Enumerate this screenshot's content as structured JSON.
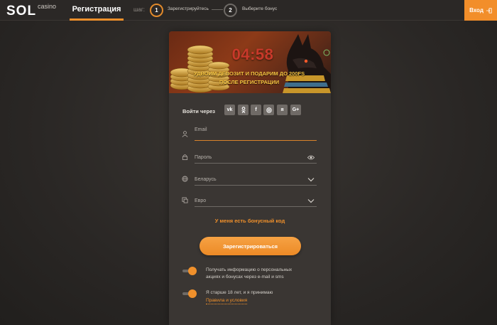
{
  "header": {
    "logo_main": "SOL",
    "logo_sub": "casino",
    "register_tab": "Регистрация",
    "steps_label": "шаг:",
    "steps": [
      {
        "number": "1",
        "label": "Зарегистрируйтесь"
      },
      {
        "number": "2",
        "label": "Выберите бонус"
      }
    ],
    "login_label": "Вход"
  },
  "banner": {
    "timer": "04:58",
    "promo_line1": "УДВОИМ ДЕПОЗИТ И ПОДАРИМ ДО 200FS",
    "promo_line2": "ПОСЛЕ РЕГИСТРАЦИИ"
  },
  "social": {
    "label": "Войти через",
    "buttons": [
      "vk",
      "ok",
      "f",
      "m",
      "я",
      "G+"
    ]
  },
  "form": {
    "email_label": "Email",
    "password_label": "Пароль",
    "country_value": "Беларусь",
    "currency_value": "Евро",
    "bonus_code_link": "У меня есть бонусный код",
    "submit_label": "Зарегистрироваться"
  },
  "consents": {
    "newsletter_text_1": "Получать информацию о персональных",
    "newsletter_text_2": "акциях и бонусах через e-mail и sms",
    "age_text": "Я старше 18 лет, и я принимаю",
    "terms_link": "Правила и условия"
  },
  "colors": {
    "accent": "#f0902b",
    "background": "#2b2826",
    "panel": "#3a3633"
  }
}
